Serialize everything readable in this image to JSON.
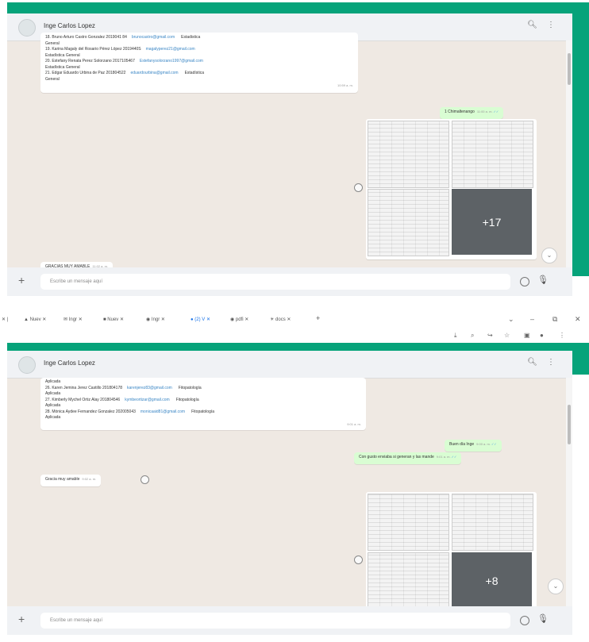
{
  "top": {
    "contact_name": "Inge Carlos Lopez",
    "search_icon": "search-icon",
    "menu_icon": "kebab-menu-icon",
    "student_rows": [
      {
        "text": "18. Bruno Arturo Castro Gonzalez   2019041 84",
        "email": "brunocastro@gmail.com",
        "area": "Estadistica"
      },
      {
        "text": "General",
        "email": "",
        "area": ""
      },
      {
        "text": "19. Karina Magaly del Rosario Pérez López   2019440S",
        "email": "magalyperez21@gmail.com",
        "area": ""
      },
      {
        "text": "Estadística General",
        "email": "",
        "area": ""
      },
      {
        "text": "20. Estefany Renata Perez Solorzano   2017105467",
        "email": "Estefanysolorzano1997@gmail.com",
        "area": ""
      },
      {
        "text": "Estadística General",
        "email": "",
        "area": ""
      },
      {
        "text": "21. Edgar Eduardo Urbina de Paz   201804522",
        "email": "eduardourbina@gmail.com",
        "area": "Estadística"
      },
      {
        "text": "General",
        "email": "",
        "area": ""
      }
    ],
    "student_time": "10:59 a. m.",
    "out_message": "1 Chimaltenango",
    "out_time": "11:00 a. m.",
    "gallery_more": "+17",
    "thanks_message": "GRACIAS MUY AMABLE",
    "thanks_time": "11:02 a. m.",
    "input_placeholder": "Escribe un mensaje aquí"
  },
  "browser": {
    "tabs": [
      "Nuev",
      "Ingr",
      "Nuev",
      "Ingr",
      "(2) V",
      "pdfi",
      "docs"
    ],
    "new_tab": "+",
    "window_controls": [
      "⌄",
      "–",
      "⧉",
      "✕"
    ],
    "toolbar_icons": [
      "⤓",
      "⌕",
      "↪",
      "☆",
      "▣",
      "●",
      "⋮"
    ]
  },
  "bottom": {
    "contact_name": "Inge Carlos Lopez",
    "student_rows": [
      {
        "text": "Aplicada",
        "email": "",
        "area": ""
      },
      {
        "text": "26. Karen Jemina Jerez Castillo   201804178",
        "email": "karenjerez83@gmail.com",
        "area": "Fitopatología"
      },
      {
        "text": "Aplicada",
        "email": "",
        "area": ""
      },
      {
        "text": "27. Kimberly Mychel Ortiz Alay   201804546",
        "email": "kymbeortizar@gmail.com",
        "area": "Fitopatología"
      },
      {
        "text": "Aplicada",
        "email": "",
        "area": ""
      },
      {
        "text": "28. Mónica Aydee Fernandez Gonzalez 202005043",
        "email": "monicaaid81@gmail.com",
        "area": "Fitopatología"
      },
      {
        "text": "Aplicada",
        "email": "",
        "area": ""
      }
    ],
    "student_time": "9:01 a. m.",
    "out_messages": [
      {
        "text": "Buen día Inge",
        "time": "9:00 a. m."
      },
      {
        "text": "Con gusto enviaba si generan y las mande",
        "time": "9:01 a. m."
      }
    ],
    "in_message": "Gracia muy amable",
    "in_time": "9:02 a. m.",
    "gallery_more": "+8",
    "input_placeholder": "Escribe un mensaje aquí"
  },
  "colors": {
    "accent_green": "#06a37a",
    "outgoing_bubble": "#d9fdd3",
    "chat_background": "#efe9e3"
  }
}
